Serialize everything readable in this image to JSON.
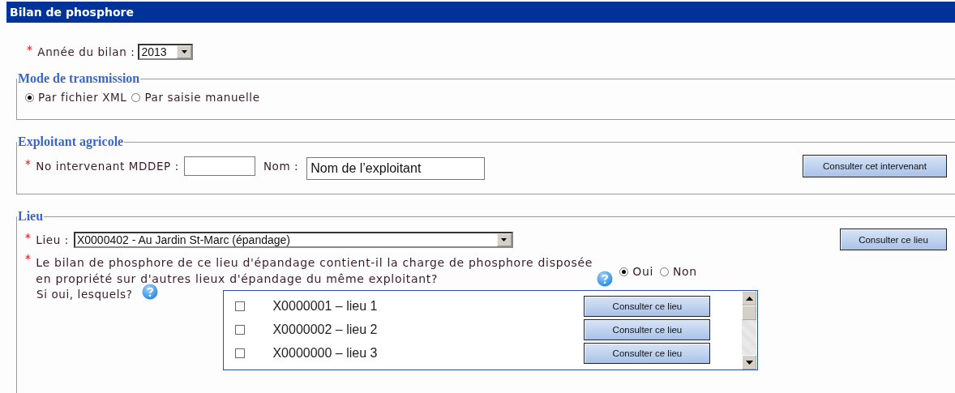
{
  "header": {
    "title": "Bilan de phosphore"
  },
  "year": {
    "required_mark": "*",
    "label": "Année du bilan :",
    "value": "2013"
  },
  "transmission": {
    "legend": "Mode de transmission",
    "options": [
      {
        "label": "Par fichier XML",
        "selected": true
      },
      {
        "label": "Par saisie manuelle",
        "selected": false
      }
    ]
  },
  "exploitant": {
    "legend": "Exploitant agricole",
    "required_mark": "*",
    "number_label": "No intervenant MDDEP :",
    "name_label": "Nom :",
    "name_value": "Nom de l’exploitant",
    "button": "Consulter cet intervenant"
  },
  "lieu": {
    "legend": "Lieu",
    "required_mark": "*",
    "label": "Lieu :",
    "value": "X0000402 - Au Jardin St-Marc (épandage)",
    "button": "Consulter ce lieu",
    "question_mark": "*",
    "question": "Le bilan de phosphore de ce lieu d'épandage contient-il la charge de phosphore disposée en propriété sur d'autres lieux d'épandage du même exploitant?",
    "answers": [
      {
        "label": "Oui",
        "selected": true
      },
      {
        "label": "Non",
        "selected": false
      }
    ],
    "followup": "Si oui, lesquels?",
    "places": [
      {
        "label": "X0000001 – lieu 1",
        "checked": false,
        "button": "Consulter ce lieu"
      },
      {
        "label": "X0000002 – lieu 2",
        "checked": false,
        "button": "Consulter ce lieu"
      },
      {
        "label": "X0000000 – lieu 3",
        "checked": false,
        "button": "Consulter ce lieu"
      }
    ]
  }
}
